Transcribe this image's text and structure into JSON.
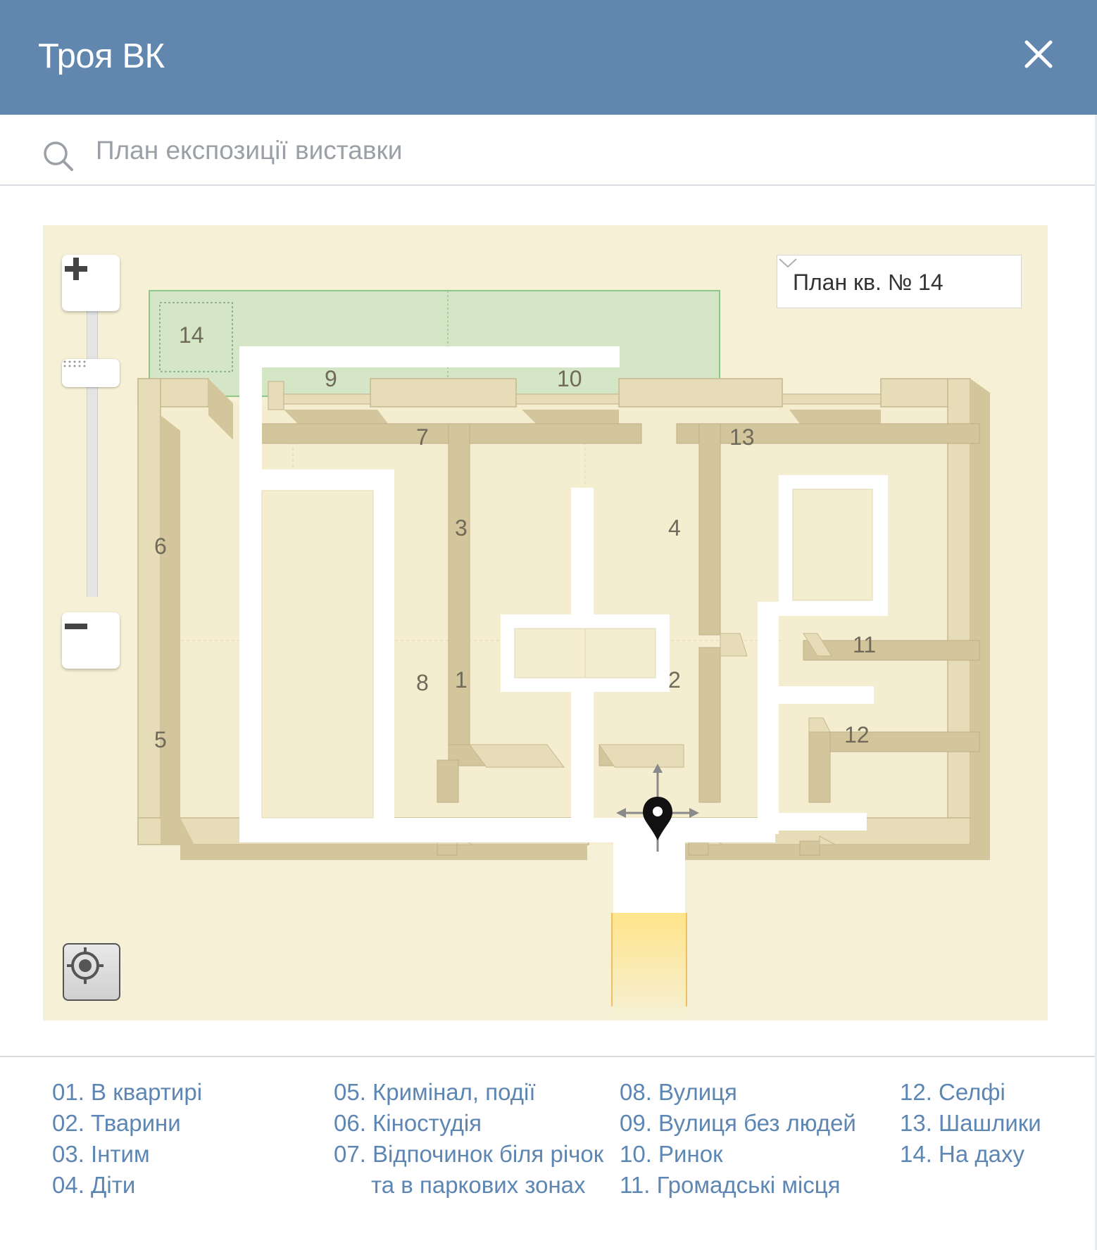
{
  "window": {
    "title": "Троя ВК"
  },
  "search": {
    "placeholder": "План експозиції виставки",
    "value": ""
  },
  "plan_select": {
    "selected": "План кв. № 14"
  },
  "map_labels": {
    "r1": "1",
    "r2": "2",
    "r3": "3",
    "r4": "4",
    "r5": "5",
    "r6": "6",
    "r7": "7",
    "r8": "8",
    "r9": "9",
    "r10": "10",
    "r11": "11",
    "r12": "12",
    "r13": "13",
    "r14": "14"
  },
  "legend": {
    "col1": [
      "01. В квартирі",
      "02. Тварини",
      "03. Інтим",
      "04. Діти"
    ],
    "col2": [
      "05. Кримінал, події",
      "06. Кіностудія",
      "07. Відпочинок біля річок",
      "та в паркових зонах"
    ],
    "col3": [
      "08. Вулиця",
      "09. Вулиця без людей",
      "10. Ринок",
      "11. Громадські місця"
    ],
    "col4": [
      "12. Селфі",
      "13. Шашлики",
      "14. На даху"
    ]
  },
  "colors": {
    "header": "#6187ae",
    "map_background": "#f6f1d6",
    "wall": "#d8cba5",
    "legend_text": "#5d86b3",
    "roof_zone": "#d4e6c6"
  },
  "icons": {
    "close": "close-icon",
    "search": "search-icon",
    "zoom_in": "plus-icon",
    "zoom_out": "minus-icon",
    "locate": "locate-target-icon",
    "select": "chevron-down-icon",
    "marker": "location-pin-icon"
  }
}
